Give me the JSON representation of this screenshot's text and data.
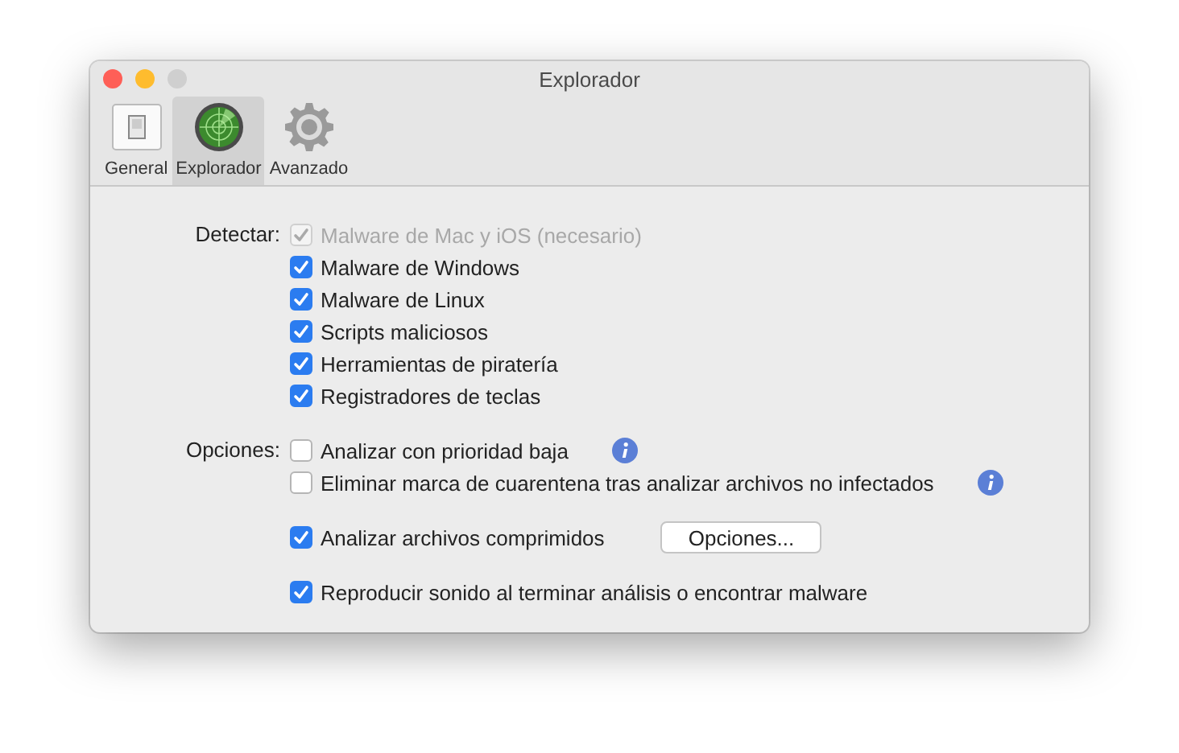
{
  "window": {
    "title": "Explorador",
    "buttons": [
      {
        "kind": "close",
        "disabled": false
      },
      {
        "kind": "minimize",
        "disabled": false
      },
      {
        "kind": "zoom",
        "disabled": true
      }
    ]
  },
  "tabs": [
    {
      "label": "General",
      "kind": "general",
      "selected": false
    },
    {
      "label": "Explorador",
      "kind": "radar",
      "selected": true
    },
    {
      "label": "Avanzado",
      "kind": "gear",
      "selected": false
    }
  ],
  "detect": {
    "label": "Detectar:",
    "items": [
      {
        "label": "Malware de Mac y iOS (necesario)",
        "checked": true,
        "disabled": true
      },
      {
        "label": "Malware de Windows",
        "checked": true,
        "disabled": false
      },
      {
        "label": "Malware de Linux",
        "checked": true,
        "disabled": false
      },
      {
        "label": "Scripts maliciosos",
        "checked": true,
        "disabled": false
      },
      {
        "label": "Herramientas de piratería",
        "checked": true,
        "disabled": false
      },
      {
        "label": "Registradores de teclas",
        "checked": true,
        "disabled": false
      }
    ]
  },
  "options": {
    "label": "Opciones:",
    "groups": [
      [
        {
          "label": "Analizar con prioridad baja",
          "checked": false,
          "info": true
        },
        {
          "label": "Eliminar marca de cuarentena tras analizar archivos no infectados",
          "checked": false,
          "info": true
        }
      ],
      [
        {
          "label": "Analizar archivos comprimidos",
          "checked": true,
          "info": false,
          "button": "Opciones..."
        }
      ],
      [
        {
          "label": "Reproducir sonido al terminar análisis o encontrar malware",
          "checked": true,
          "info": false
        }
      ]
    ]
  }
}
